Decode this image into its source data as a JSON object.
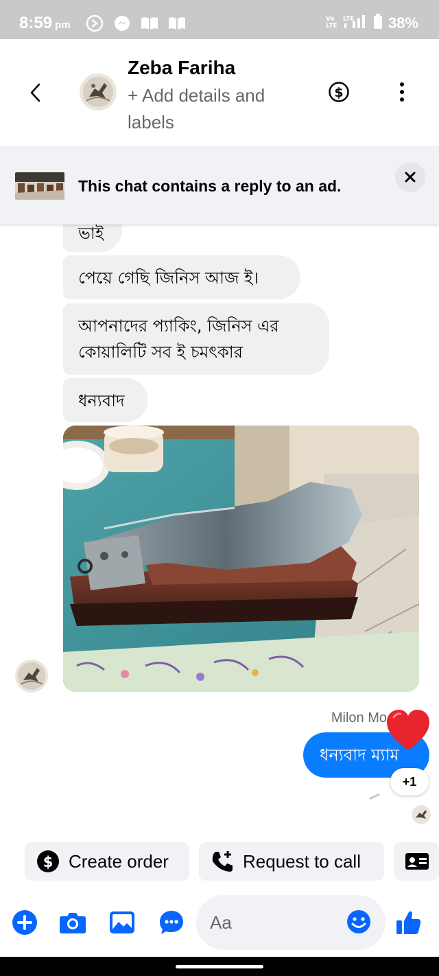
{
  "status_bar": {
    "time": "8:59",
    "ampm": "pm",
    "battery": "38%",
    "app_icons": [
      "refresh-icon",
      "messenger-icon",
      "book-icon",
      "book-icon"
    ],
    "network_icons": [
      "volte-icon",
      "lte-signal-icon",
      "battery-icon"
    ]
  },
  "header": {
    "contact_name": "Zeba Fariha",
    "add_details": "+ Add details and labels",
    "icons": [
      "back-arrow-icon",
      "dollar-icon",
      "more-vertical-icon"
    ]
  },
  "ad_banner": {
    "text": "This chat contains a reply to an ad.",
    "close_icon": "close-icon"
  },
  "messages": {
    "incoming": [
      "ভাই",
      "পেয়ে গেছি জিনিস আজ ই।",
      "আপনাদের প্যাকিং, জিনিস এর কোয়ালিটি সব ই চমৎকার",
      "ধন্যবাদ"
    ],
    "outgoing_sender": "Milon Mo",
    "outgoing_text": "ধন্যবাদ ম্যাম",
    "reaction": "heart",
    "reaction_count": "+1"
  },
  "quick_actions": {
    "create_order": "Create order",
    "request_call": "Request to call"
  },
  "composer": {
    "placeholder": "Aa",
    "icons": [
      "plus-icon",
      "camera-icon",
      "image-icon",
      "chat-bubble-icon",
      "emoji-icon",
      "thumbs-up-icon"
    ]
  },
  "colors": {
    "accent": "#0a7cff",
    "icon_blue": "#0866ff",
    "bubble_gray": "#f0f0f0",
    "status_bar": "#c9c9c9",
    "heart": "#e8242c"
  }
}
